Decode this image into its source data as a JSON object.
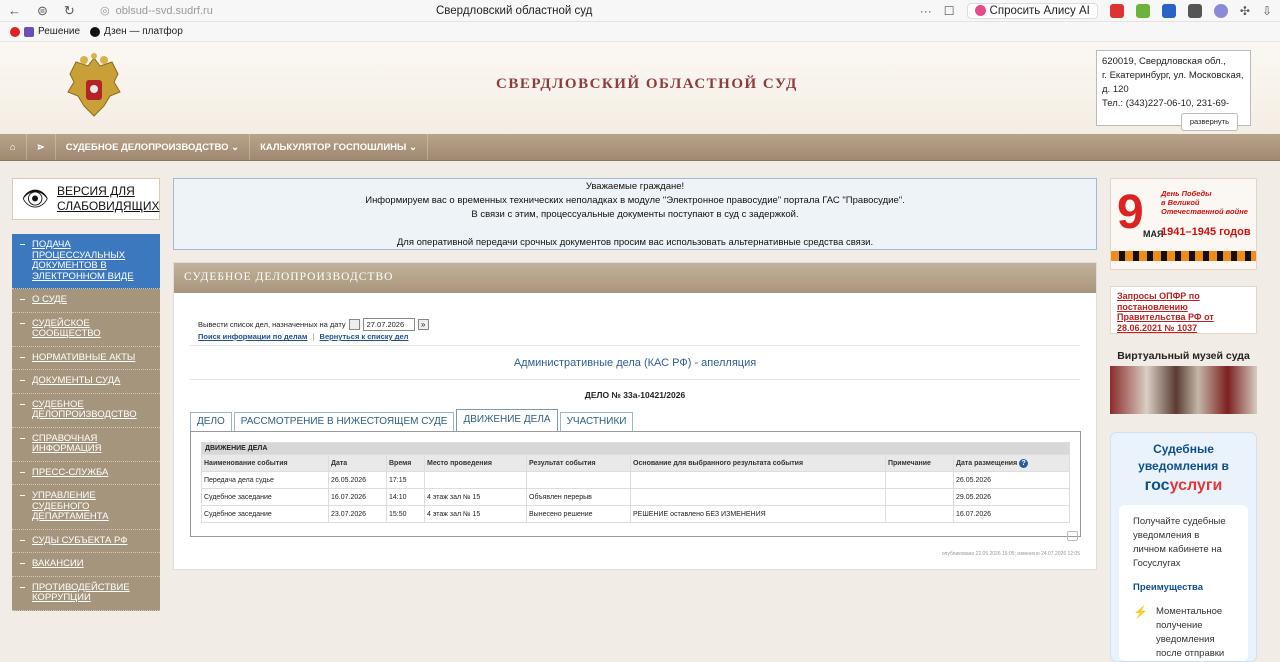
{
  "browser": {
    "url": "oblsud--svd.sudrf.ru",
    "tab_title": "Свердловский областной суд",
    "alice_label": "Спросить Алису AI",
    "ellipsis": "···",
    "bookmarks": [
      "Решение",
      "Дзен — платфор"
    ]
  },
  "header": {
    "title": "СВЕРДЛОВСКИЙ ОБЛАСТНОЙ СУД",
    "contact_lines": [
      "620019, Свердловская обл.,",
      "г. Екатеринбург, ул. Московская,",
      "д. 120",
      "Тел.: (343)227-06-10, 231-69-"
    ],
    "expand_label": "развернуть"
  },
  "menu": {
    "items": [
      "СУДЕБНОЕ ДЕЛОПРОИЗВОДСТВО ⌄",
      "КАЛЬКУЛЯТОР ГОСПОШЛИНЫ ⌄"
    ]
  },
  "left": {
    "vision_label": "ВЕРСИЯ ДЛЯ СЛАБОВИДЯЩИХ",
    "nav": [
      "ПОДАЧА ПРОЦЕССУАЛЬНЫХ ДОКУМЕНТОВ В ЭЛЕКТРОННОМ ВИДЕ",
      "О СУДЕ",
      "СУДЕЙСКОЕ СООБЩЕСТВО",
      "НОРМАТИВНЫЕ АКТЫ",
      "ДОКУМЕНТЫ СУДА",
      "СУДЕБНОЕ ДЕЛОПРОИЗВОДСТВО",
      "СПРАВОЧНАЯ ИНФОРМАЦИЯ",
      "ПРЕСС-СЛУЖБА",
      "УПРАВЛЕНИЕ СУДЕБНОГО ДЕПАРТАМЕНТА",
      "СУДЫ СУБЪЕКТА РФ",
      "ВАКАНСИИ",
      "ПРОТИВОДЕЙСТВИЕ КОРРУПЦИИ"
    ]
  },
  "notice": {
    "lines": [
      "Уважаемые граждане!",
      "Информируем вас о временных технических неполадках в модуле \"Электронное правосудие\" портала ГАС \"Правосудие\".",
      "В связи с этим, процессуальные документы поступают в суд с задержкой.",
      "",
      "Для оперативной передачи срочных документов просим вас использовать альтернативные средства связи."
    ]
  },
  "panel": {
    "title": "СУДЕБНОЕ ДЕЛОПРОИЗВОДСТВО",
    "date_label": "Вывести список дел, назначенных на дату",
    "date_value": "27.07.2026",
    "link_search": "Поиск информации по делам",
    "link_sep": "|",
    "link_back": "Вернуться к списку дел",
    "caption": "Административные дела (КАС РФ) - апелляция",
    "case_number": "ДЕЛО № 33а-10421/2026",
    "tabs": [
      "ДЕЛО",
      "РАССМОТРЕНИЕ В НИЖЕСТОЯЩЕМ СУДЕ",
      "ДВИЖЕНИЕ ДЕЛА",
      "УЧАСТНИКИ"
    ],
    "table_caption": "ДВИЖЕНИЕ ДЕЛА",
    "columns": [
      "Наименование события",
      "Дата",
      "Время",
      "Место проведения",
      "Результат события",
      "Основание для выбранного результата события",
      "Примечание",
      "Дата размещения"
    ],
    "rows": [
      [
        "Передача дела судье",
        "26.05.2026",
        "17:15",
        "",
        "",
        "",
        "",
        "26.05.2026"
      ],
      [
        "Судебное заседание",
        "16.07.2026",
        "14:10",
        "4 этаж зал № 15",
        "Объявлен перерыв",
        "",
        "",
        "29.05.2026"
      ],
      [
        "Судебное заседание",
        "23.07.2026",
        "15:50",
        "4 этаж зал № 15",
        "Вынесено решение",
        "РЕШЕНИЕ оставлено БЕЗ ИЗМЕНЕНИЯ",
        "",
        "16.07.2026"
      ]
    ],
    "stamp": "опубликовано 22.05.2026 15:05; изменено 24.07.2026 12:05"
  },
  "right": {
    "victory_lines": [
      "День Победы",
      "в Великой",
      "Отечественной войне"
    ],
    "victory_nine": "9",
    "victory_may": "МАЯ",
    "victory_years": "1941–1945 годов",
    "opfr_text": "Запросы ОПФР по постановлению Правительства РФ от 28.06.2021 № 1037",
    "museum_title": "Виртуальный музей суда",
    "gos_title": "Судебные уведомления в",
    "gos_logo_1": "гос",
    "gos_logo_2": "услуги",
    "gos_desc": "Получайте судебные уведомления в личном кабинете на Госуслугах",
    "gos_adv": "Преимущества",
    "gos_item": "Моментальное получение уведомления после отправки"
  }
}
